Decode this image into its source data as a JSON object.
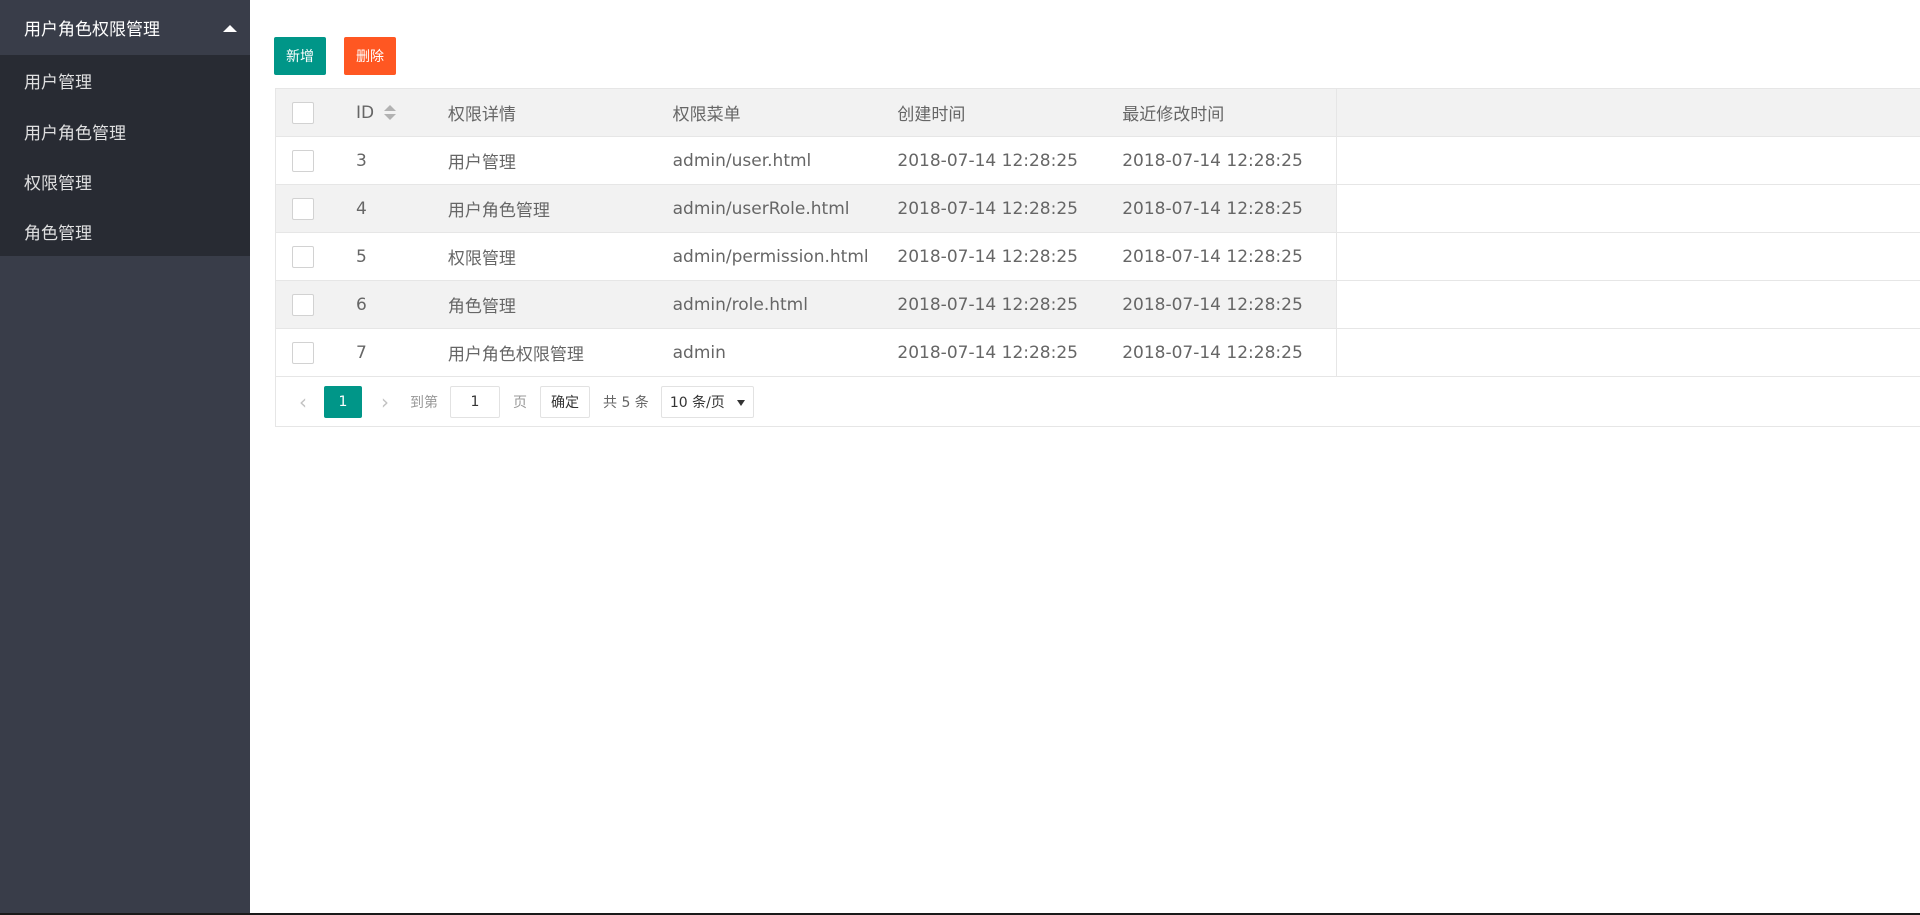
{
  "sidebar": {
    "group_title": "用户角色权限管理",
    "items": [
      {
        "label": "用户管理"
      },
      {
        "label": "用户角色管理"
      },
      {
        "label": "权限管理"
      },
      {
        "label": "角色管理"
      }
    ]
  },
  "toolbar": {
    "add_label": "新增",
    "delete_label": "删除"
  },
  "colors": {
    "add": "#009688",
    "delete": "#ff5722",
    "sidebar_bg": "#393d49",
    "submenu_bg": "#282b33"
  },
  "table": {
    "headers": {
      "id": "ID",
      "detail": "权限详情",
      "menu": "权限菜单",
      "created": "创建时间",
      "modified": "最近修改时间"
    },
    "rows": [
      {
        "id": "3",
        "detail": "用户管理",
        "menu": "admin/user.html",
        "created": "2018-07-14 12:28:25",
        "modified": "2018-07-14 12:28:25"
      },
      {
        "id": "4",
        "detail": "用户角色管理",
        "menu": "admin/userRole.html",
        "created": "2018-07-14 12:28:25",
        "modified": "2018-07-14 12:28:25"
      },
      {
        "id": "5",
        "detail": "权限管理",
        "menu": "admin/permission.html",
        "created": "2018-07-14 12:28:25",
        "modified": "2018-07-14 12:28:25"
      },
      {
        "id": "6",
        "detail": "角色管理",
        "menu": "admin/role.html",
        "created": "2018-07-14 12:28:25",
        "modified": "2018-07-14 12:28:25"
      },
      {
        "id": "7",
        "detail": "用户角色权限管理",
        "menu": "admin",
        "created": "2018-07-14 12:28:25",
        "modified": "2018-07-14 12:28:25"
      }
    ]
  },
  "pager": {
    "prev_icon": "‹",
    "next_icon": "›",
    "current_page": "1",
    "goto_label": "到第",
    "goto_value": "1",
    "page_label": "页",
    "confirm_label": "确定",
    "total_label": "共 5 条",
    "limit_label": "10 条/页"
  }
}
